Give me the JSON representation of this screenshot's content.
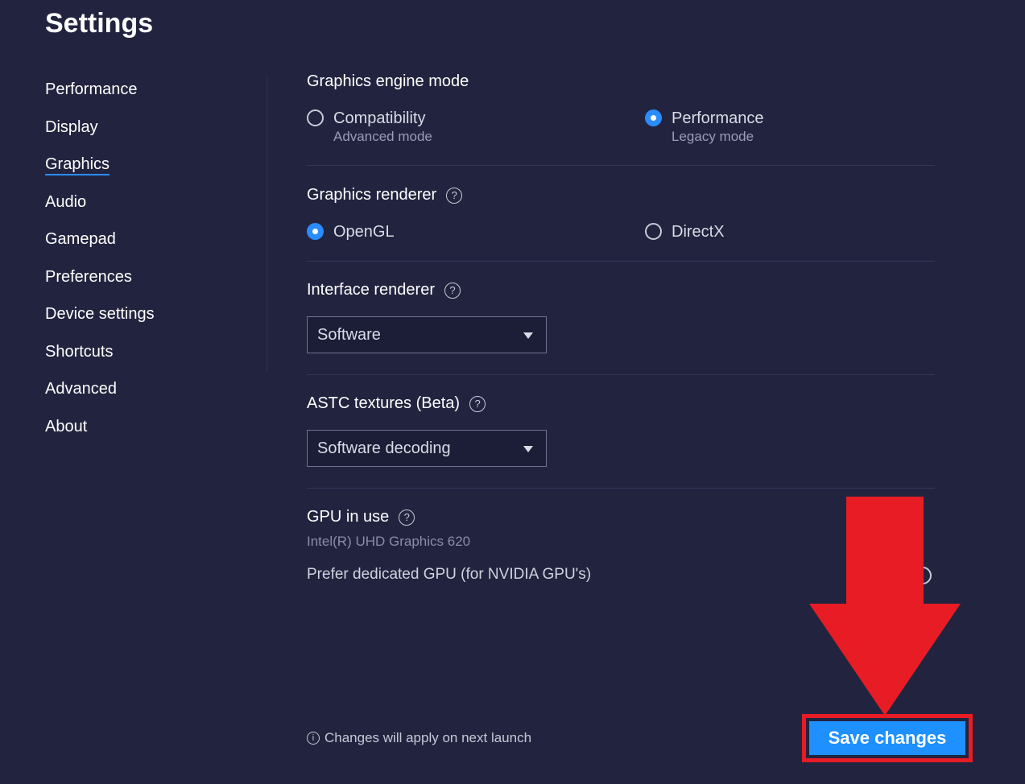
{
  "page_title": "Settings",
  "sidebar": {
    "items": [
      {
        "label": "Performance"
      },
      {
        "label": "Display"
      },
      {
        "label": "Graphics",
        "active": true
      },
      {
        "label": "Audio"
      },
      {
        "label": "Gamepad"
      },
      {
        "label": "Preferences"
      },
      {
        "label": "Device settings"
      },
      {
        "label": "Shortcuts"
      },
      {
        "label": "Advanced"
      },
      {
        "label": "About"
      }
    ]
  },
  "graphics_engine": {
    "title": "Graphics engine mode",
    "options": [
      {
        "label": "Compatibility",
        "sub": "Advanced mode",
        "checked": false
      },
      {
        "label": "Performance",
        "sub": "Legacy mode",
        "checked": true
      }
    ]
  },
  "graphics_renderer": {
    "title": "Graphics renderer",
    "options": [
      {
        "label": "OpenGL",
        "checked": true
      },
      {
        "label": "DirectX",
        "checked": false
      }
    ]
  },
  "interface_renderer": {
    "title": "Interface renderer",
    "selected": "Software"
  },
  "astc_textures": {
    "title": "ASTC textures (Beta)",
    "selected": "Software decoding"
  },
  "gpu": {
    "title": "GPU in use",
    "name": "Intel(R) UHD Graphics 620",
    "prefer_label": "Prefer dedicated GPU (for NVIDIA GPU's)"
  },
  "footer": {
    "note": "Changes will apply on next launch",
    "save_label": "Save changes"
  },
  "icons": {
    "help": "?",
    "info": "i"
  },
  "colors": {
    "background": "#22243f",
    "accent": "#2b8cff",
    "save_button": "#1e90ff",
    "annotation_red": "#e81c24"
  }
}
